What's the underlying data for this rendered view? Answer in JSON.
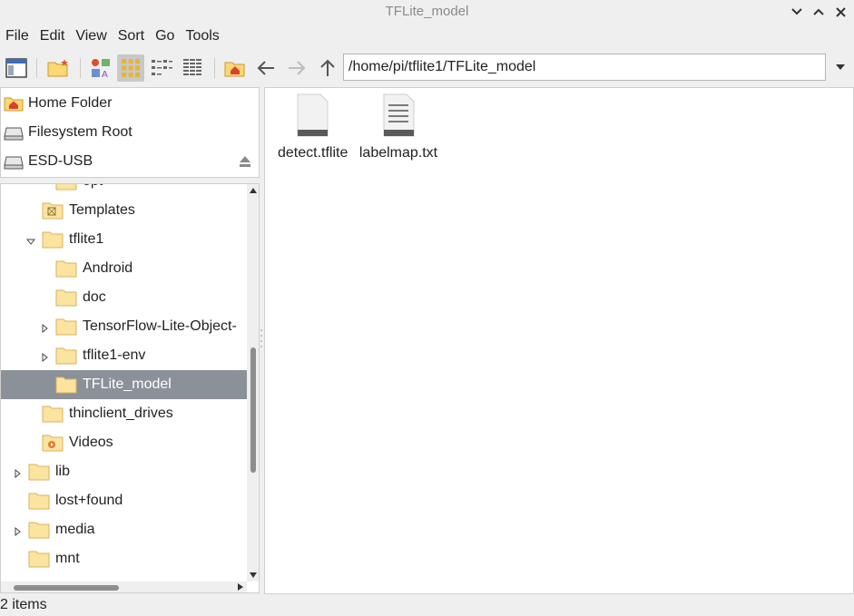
{
  "window": {
    "title": "TFLite_model"
  },
  "menu": [
    "File",
    "Edit",
    "View",
    "Sort",
    "Go",
    "Tools"
  ],
  "toolbar": {
    "path": "/home/pi/tflite1/TFLite_model",
    "active_view": "icon-view"
  },
  "places": [
    {
      "label": "Home Folder",
      "icon": "home-folder-icon"
    },
    {
      "label": "Filesystem Root",
      "icon": "drive-icon"
    },
    {
      "label": "ESD-USB",
      "icon": "drive-icon",
      "ejectable": true
    }
  ],
  "tree": {
    "partial_top": "opt",
    "nodes": [
      {
        "label": "Templates",
        "icon": "templates-folder-icon",
        "expander": "none"
      },
      {
        "label": "tflite1",
        "icon": "folder-icon",
        "expander": "expanded"
      },
      {
        "label": "Android",
        "icon": "folder-icon",
        "expander": "none"
      },
      {
        "label": "doc",
        "icon": "folder-icon",
        "expander": "none"
      },
      {
        "label": "TensorFlow-Lite-Object-",
        "icon": "folder-icon",
        "expander": "collapsed"
      },
      {
        "label": "tflite1-env",
        "icon": "folder-icon",
        "expander": "collapsed"
      },
      {
        "label": "TFLite_model",
        "icon": "folder-icon",
        "expander": "none",
        "selected": true
      },
      {
        "label": "thinclient_drives",
        "icon": "folder-icon",
        "expander": "none"
      },
      {
        "label": "Videos",
        "icon": "videos-folder-icon",
        "expander": "none"
      },
      {
        "label": "lib",
        "icon": "folder-icon",
        "expander": "collapsed"
      },
      {
        "label": "lost+found",
        "icon": "folder-icon",
        "expander": "none"
      },
      {
        "label": "media",
        "icon": "folder-icon",
        "expander": "collapsed"
      },
      {
        "label": "mnt",
        "icon": "folder-icon",
        "expander": "none"
      }
    ]
  },
  "files": [
    {
      "name": "detect.tflite",
      "icon": "generic-file-icon"
    },
    {
      "name": "labelmap.txt",
      "icon": "text-file-icon"
    }
  ],
  "status": {
    "text": "2 items"
  },
  "colors": {
    "selection": "#8a9199",
    "folder": "#fbe3a0",
    "folder_border": "#d8b35b",
    "home_red": "#d9412f"
  }
}
